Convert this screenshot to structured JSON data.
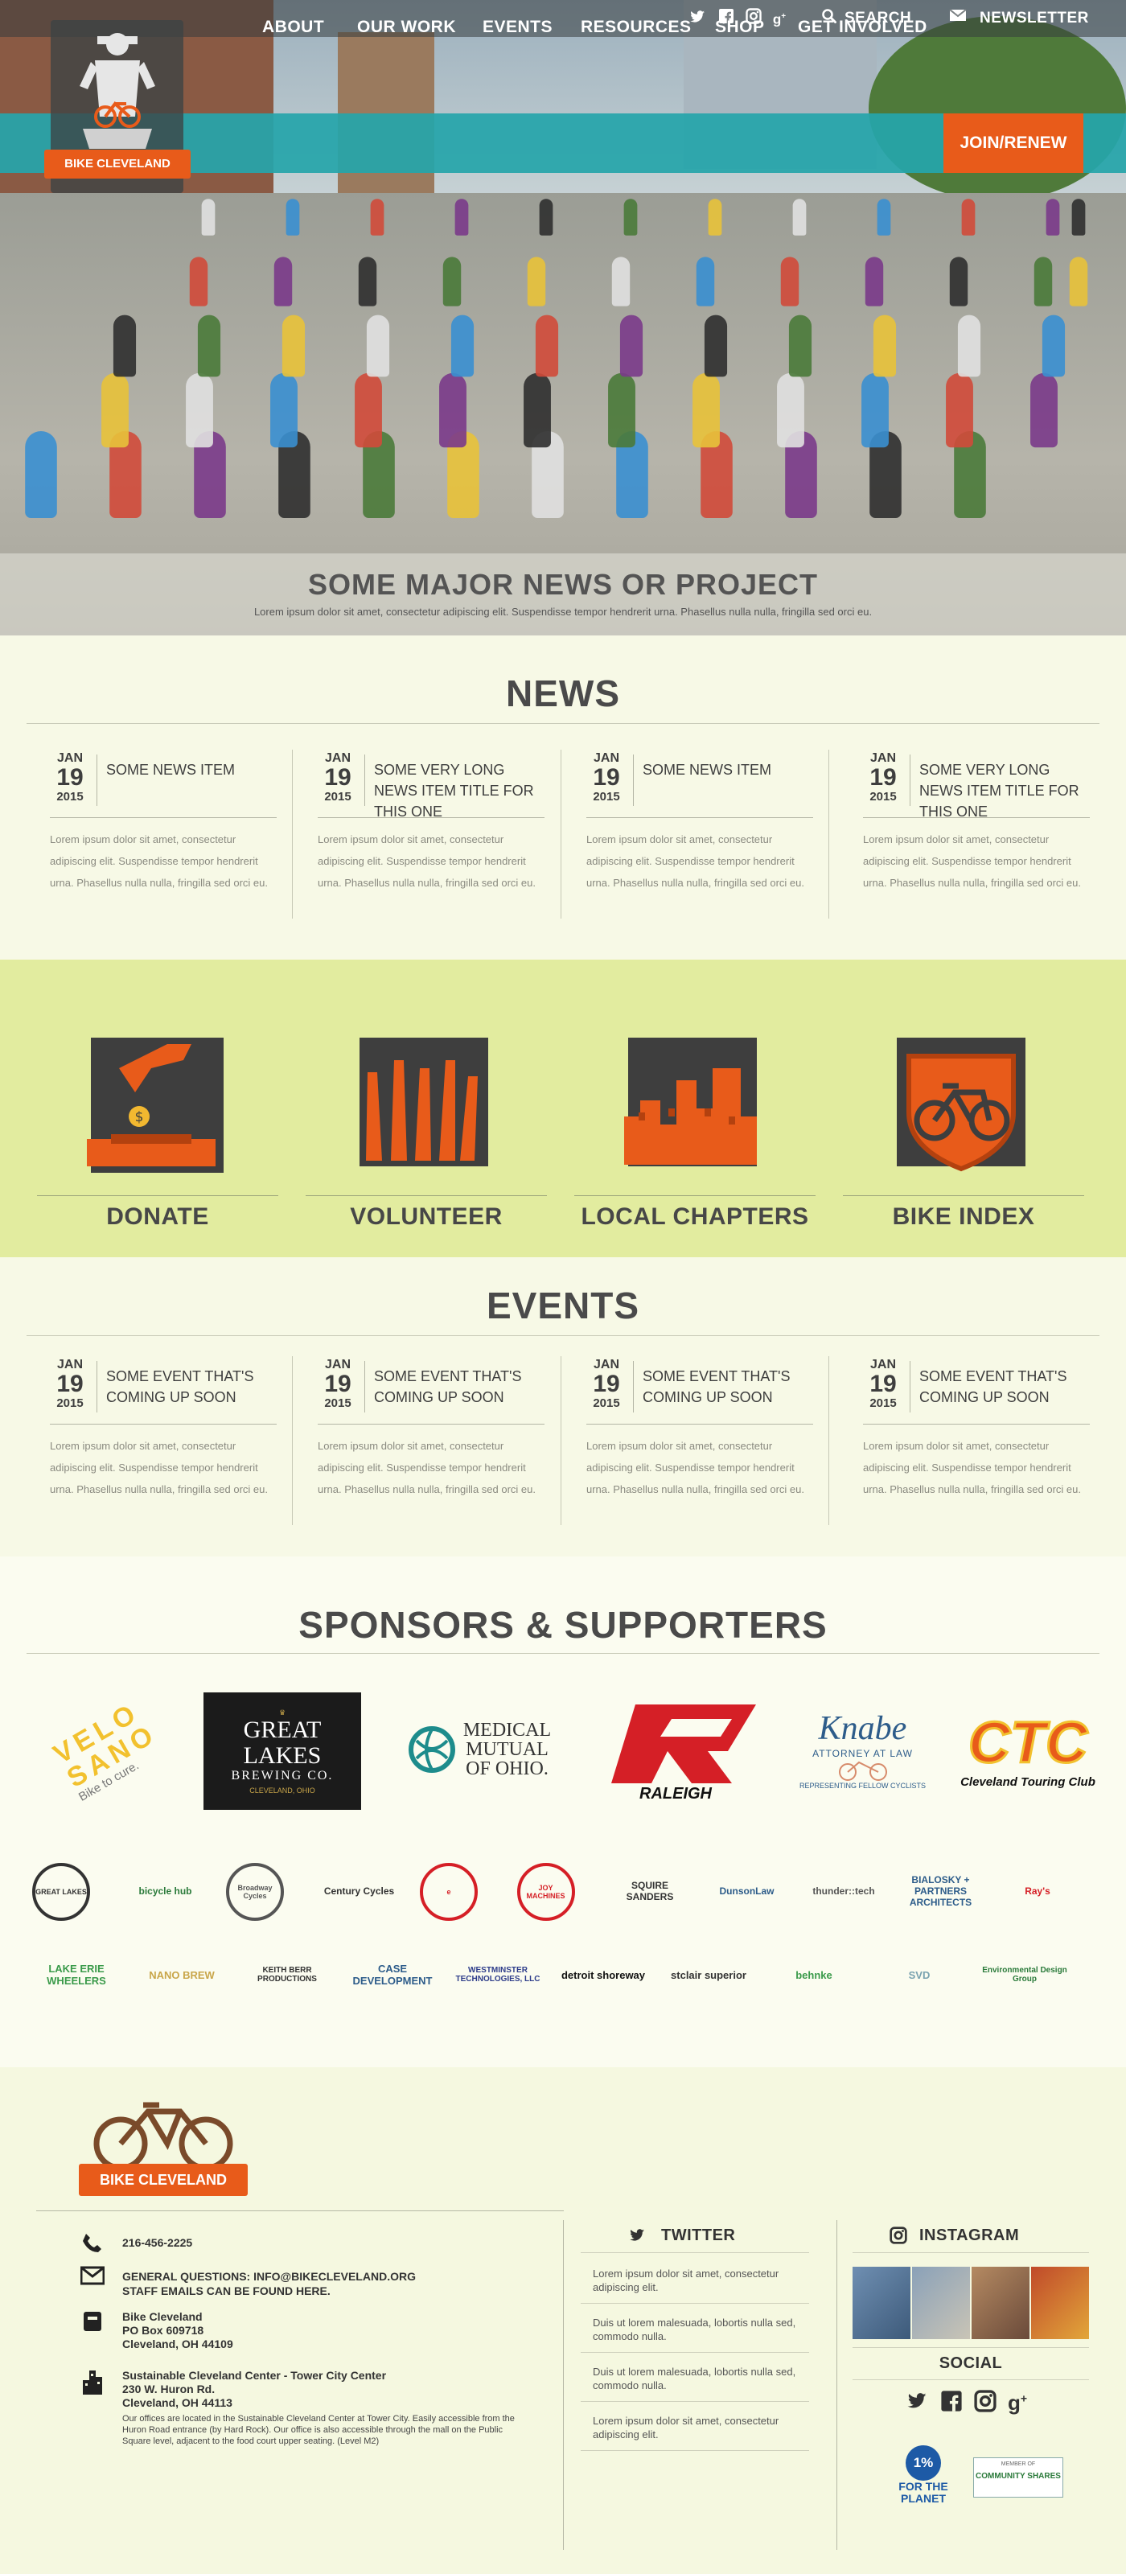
{
  "topbar": {
    "search_label": "SEARCH",
    "newsletter_label": "NEWSLETTER"
  },
  "brand": {
    "name": "BIKE CLEVELAND"
  },
  "nav": {
    "items": [
      "ABOUT",
      "OUR WORK",
      "EVENTS",
      "RESOURCES",
      "SHOP",
      "GET INVOLVED"
    ],
    "join_label": "JOIN/RENEW"
  },
  "hero": {
    "title": "SOME MAJOR NEWS OR PROJECT",
    "subtitle": "Lorem ipsum dolor sit amet, consectetur adipiscing elit. Suspendisse tempor hendrerit urna. Phasellus nulla nulla, fringilla sed orci eu."
  },
  "news": {
    "title": "NEWS",
    "items": [
      {
        "mon": "JAN",
        "day": "19",
        "yr": "2015",
        "title": "SOME NEWS ITEM",
        "body": "Lorem ipsum dolor sit amet, consectetur adipiscing elit. Suspendisse tempor hendrerit urna. Phasellus nulla nulla, fringilla sed orci eu."
      },
      {
        "mon": "JAN",
        "day": "19",
        "yr": "2015",
        "title": "SOME VERY LONG NEWS ITEM TITLE FOR THIS ONE",
        "body": "Lorem ipsum dolor sit amet, consectetur adipiscing elit. Suspendisse tempor hendrerit urna. Phasellus nulla nulla, fringilla sed orci eu."
      },
      {
        "mon": "JAN",
        "day": "19",
        "yr": "2015",
        "title": "SOME NEWS ITEM",
        "body": "Lorem ipsum dolor sit amet, consectetur adipiscing elit. Suspendisse tempor hendrerit urna. Phasellus nulla nulla, fringilla sed orci eu."
      },
      {
        "mon": "JAN",
        "day": "19",
        "yr": "2015",
        "title": "SOME VERY LONG NEWS ITEM TITLE FOR THIS ONE",
        "body": "Lorem ipsum dolor sit amet, consectetur adipiscing elit. Suspendisse tempor hendrerit urna. Phasellus nulla nulla, fringilla sed orci eu."
      }
    ]
  },
  "help": {
    "items": [
      "DONATE",
      "VOLUNTEER",
      "LOCAL CHAPTERS",
      "BIKE INDEX"
    ]
  },
  "events": {
    "title": "EVENTS",
    "items": [
      {
        "mon": "JAN",
        "day": "19",
        "yr": "2015",
        "title": "SOME EVENT THAT'S COMING UP SOON",
        "body": "Lorem ipsum dolor sit amet, consectetur adipiscing elit. Suspendisse tempor hendrerit urna. Phasellus nulla nulla, fringilla sed orci eu."
      },
      {
        "mon": "JAN",
        "day": "19",
        "yr": "2015",
        "title": "SOME EVENT THAT'S COMING UP SOON",
        "body": "Lorem ipsum dolor sit amet, consectetur adipiscing elit. Suspendisse tempor hendrerit urna. Phasellus nulla nulla, fringilla sed orci eu."
      },
      {
        "mon": "JAN",
        "day": "19",
        "yr": "2015",
        "title": "SOME EVENT THAT'S COMING UP SOON",
        "body": "Lorem ipsum dolor sit amet, consectetur adipiscing elit. Suspendisse tempor hendrerit urna. Phasellus nulla nulla, fringilla sed orci eu."
      },
      {
        "mon": "JAN",
        "day": "19",
        "yr": "2015",
        "title": "SOME EVENT THAT'S COMING UP SOON",
        "body": "Lorem ipsum dolor sit amet, consectetur adipiscing elit. Suspendisse tempor hendrerit urna. Phasellus nulla nulla, fringilla sed orci eu."
      }
    ]
  },
  "sponsors": {
    "title": "SPONSORS & SUPPORTERS",
    "major": {
      "velosano": {
        "line1": "VELO",
        "line2": "SANO",
        "tagline": "Bike to cure."
      },
      "greatlakes": {
        "line1": "GREAT LAKES",
        "line2": "BREWING CO.",
        "line3": "CLEVELAND, OHIO"
      },
      "medical": {
        "line1": "MEDICAL",
        "line2": "MUTUAL",
        "line3": "OF OHIO."
      },
      "raleigh": {
        "name": "RALEIGH"
      },
      "knabe": {
        "name": "Knabe",
        "line2": "ATTORNEY AT LAW",
        "line3": "REPRESENTING FELLOW CYCLISTS"
      },
      "ctc": {
        "mark": "CTC",
        "name": "Cleveland Touring Club"
      }
    },
    "row1": [
      "GREAT LAKES",
      "bicycle hub",
      "Broadway Cycles",
      "Century Cycles",
      "e",
      "JOY MACHINES",
      "SQUIRE SANDERS",
      "DunsonLaw",
      "thunder::tech",
      "BIALOSKY + PARTNERS ARCHITECTS",
      "Ray's"
    ],
    "row2": [
      "LAKE ERIE WHEELERS",
      "NANO BREW",
      "KEITH BERR PRODUCTIONS",
      "CASE DEVELOPMENT",
      "WESTMINSTER TECHNOLOGIES, LLC",
      "detroit shoreway",
      "stclair superior",
      "behnke",
      "SVD",
      "Environmental Design Group"
    ]
  },
  "footer": {
    "phone": "216-456-2225",
    "general": "General questions: info@bikecleveland.org",
    "staff": "Staff emails can be found here.",
    "addr1": [
      "Bike Cleveland",
      "PO Box 609718",
      "Cleveland, OH 44109"
    ],
    "addr2": [
      "Sustainable Cleveland Center - Tower City Center",
      "230 W. Huron Rd.",
      "Cleveland, OH 44113"
    ],
    "note": "Our offices are located in the Sustainable Cleveland Center at Tower City. Easily accessible from the Huron Road entrance (by Hard Rock). Our office is also accessible through the mall on the Public Square level, adjacent to the food court upper seating. (Level M2)",
    "twitter_title": "TWITTER",
    "tweets": [
      "Lorem ipsum dolor sit amet, consectetur adipiscing elit.",
      "Duis ut lorem malesuada, lobortis nulla sed, commodo nulla.",
      "Duis ut lorem malesuada, lobortis nulla sed, commodo nulla.",
      "Lorem ipsum dolor sit amet, consectetur adipiscing elit."
    ],
    "instagram_title": "INSTAGRAM",
    "social_title": "SOCIAL",
    "onepct": {
      "mark": "1%",
      "line1": "FOR THE",
      "line2": "PLANET"
    },
    "shares": {
      "top": "MEMBER OF",
      "name": "COMMUNITY SHARES"
    }
  },
  "colors": {
    "teal": "#26a5aa",
    "orange": "#e85b1a",
    "lime": "#e2ec9f",
    "cream": "#f7f9e6",
    "dark": "#474747"
  }
}
